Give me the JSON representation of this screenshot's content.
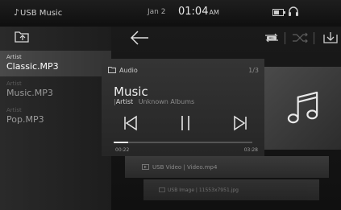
{
  "status_bar": {
    "source": "USB Music",
    "date": "Jan 2",
    "time": "01:04",
    "ampm": "AM"
  },
  "sidebar": {
    "items": [
      {
        "category": "Artist",
        "title": "Classic.MP3",
        "active": true
      },
      {
        "category": "Artist",
        "title": "Music.MP3",
        "active": false
      },
      {
        "category": "Artist",
        "title": "Pop.MP3",
        "active": false
      }
    ]
  },
  "toolbar": {
    "back": "back-arrow-icon",
    "repeat_badge": "ALL"
  },
  "now_playing": {
    "source_label": "Audio",
    "index": "1/3",
    "title": "Music",
    "artist_label": "Artist",
    "album": "Unknown Albums",
    "elapsed": "00:22",
    "total": "03:28",
    "progress_fraction": 0.106
  },
  "background_cards": [
    {
      "label": "USB Video | Video.mp4"
    },
    {
      "label": "USB Image | 11553x7951.jpg"
    }
  ],
  "colors": {
    "background": "#0d0d0d",
    "card": "#303030",
    "text": "#e8e8e8",
    "muted": "#8a8a8a"
  }
}
